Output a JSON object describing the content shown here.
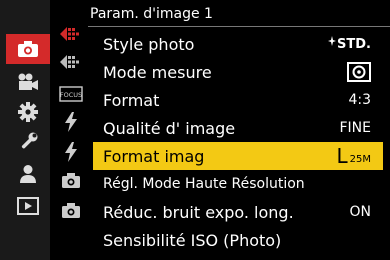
{
  "page": {
    "title": "Param. d'image 1"
  },
  "colors": {
    "accent": "#d42a2a",
    "highlight": "#f3c914"
  },
  "categories": [
    {
      "name": "photo-menu",
      "icon": "camera-icon",
      "active": true
    },
    {
      "name": "video-menu",
      "icon": "movie-camera-icon",
      "active": false
    },
    {
      "name": "custom-menu",
      "icon": "gear-icon",
      "active": false
    },
    {
      "name": "setup-menu",
      "icon": "wrench-icon",
      "active": false
    },
    {
      "name": "my-menu",
      "icon": "person-icon",
      "active": false
    },
    {
      "name": "playback-menu",
      "icon": "play-icon",
      "active": false
    }
  ],
  "sub_pages": [
    {
      "icon": "red-arrow-page-icon",
      "active": true
    },
    {
      "icon": "grey-arrow-page-icon",
      "active": false
    },
    {
      "icon": "focus-icon",
      "text": "FOCUS"
    },
    {
      "icon": "flash-icon"
    },
    {
      "icon": "flash-icon"
    },
    {
      "icon": "camera-small-icon"
    },
    {
      "icon": "camera-small-icon"
    }
  ],
  "menu": {
    "items": [
      {
        "label": "Style photo",
        "value": "STD."
      },
      {
        "label": "Mode mesure",
        "value": ""
      },
      {
        "label": "Format",
        "value": "4:3"
      },
      {
        "label": "Qualité d' image",
        "value": "FINE"
      },
      {
        "label": "Format imag",
        "value_letter": "L",
        "value_size": "25M",
        "selected": true
      },
      {
        "label": "Régl. Mode Haute Résolution",
        "value": ""
      },
      {
        "label": "Réduc. bruit expo. long.",
        "value": "ON"
      },
      {
        "label": "Sensibilité ISO (Photo)",
        "value": ""
      }
    ]
  }
}
